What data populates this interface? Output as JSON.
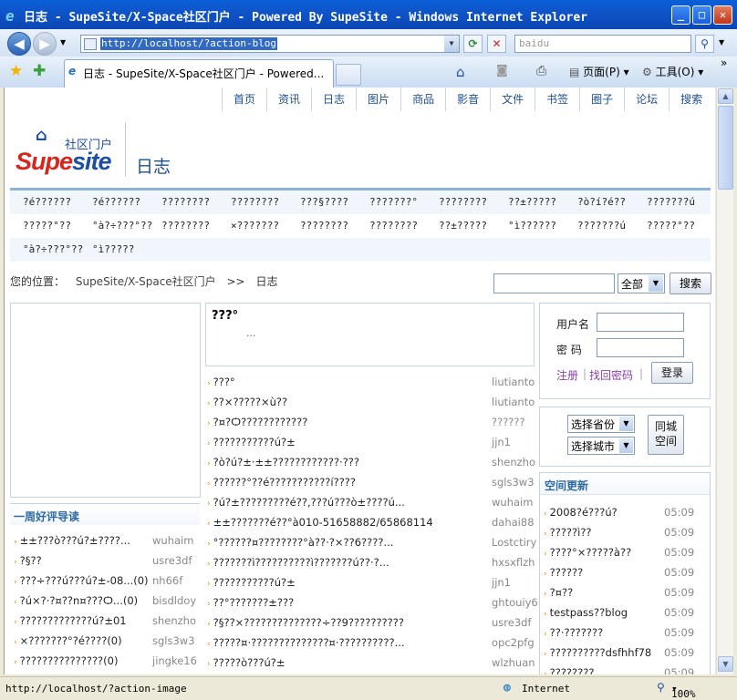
{
  "window": {
    "title": "日志 - SupeSite/X-Space社区门户 - Powered By SupeSite - Windows Internet Explorer"
  },
  "browser": {
    "address": "http://localhost/?action-blog",
    "search_placeholder": "baidu",
    "tab_title": "日志 - SupeSite/X-Space社区门户 - Powered...",
    "page_menu": "页面(P)",
    "tools_menu": "工具(O)",
    "status_url": "http://localhost/?action-image",
    "zone": "Internet",
    "zoom": "100%"
  },
  "site": {
    "nav": [
      "首页",
      "资讯",
      "日志",
      "图片",
      "商品",
      "影音",
      "文件",
      "书签",
      "圈子",
      "论坛",
      "搜索"
    ],
    "logo_cn": "社区门户",
    "logo_supe": "Supe",
    "logo_site": "site",
    "page_title": "日志",
    "categories": [
      [
        "?é??????",
        "?é??????",
        "????????",
        "????????",
        "???§????",
        "???????°",
        "????????",
        "??±?????",
        "?ò?í?é??",
        "???????ú"
      ],
      [
        "?????°??",
        "°à?÷???°??",
        "????????",
        "×???????",
        "????????",
        "????????",
        "??±?????",
        "°ì??????",
        "???????ú",
        "?????°??"
      ],
      [
        "°à?÷???°??",
        "°ì?????"
      ]
    ],
    "breadcrumb": {
      "label": "您的位置：",
      "home": "SupeSite/X-Space社区门户",
      "sep": ">>",
      "current": "日志"
    },
    "search": {
      "select": "全部",
      "button": "搜索"
    }
  },
  "left": {
    "heading": "一周好评导读",
    "items": [
      {
        "t": "±±???ò???ú?±????...",
        "n": "wuhaim"
      },
      {
        "t": "?§??",
        "n": "usre3df"
      },
      {
        "t": "???÷???ú???ú?±-08...(0)",
        "n": "nh66f"
      },
      {
        "t": "?ú×?·?¤??n¤???Ѻ...(0)",
        "n": "bisdldoy"
      },
      {
        "t": "?????????????ú?±01",
        "n": "shenzho"
      },
      {
        "t": "×???????°?é????(0)",
        "n": "sgls3w3"
      },
      {
        "t": "???????????????(0)",
        "n": "jingke16"
      }
    ]
  },
  "middle": {
    "head_title": "???°",
    "head_sub": "...",
    "items": [
      {
        "t": "???°",
        "n": "liutianto"
      },
      {
        "t": "??×?????×ù??",
        "n": "liutianto"
      },
      {
        "t": "?¤?Ѻ????????????",
        "n": "??????"
      },
      {
        "t": "???????????ú?±",
        "n": "jjn1"
      },
      {
        "t": "?ò?ú?±·±±????????????·???",
        "n": "shenzho"
      },
      {
        "t": "??????°??é???????????í????",
        "n": "sgls3w3"
      },
      {
        "t": "?ú?±?????????é??,???ú???ò±????ú...",
        "n": "wuhaim"
      },
      {
        "t": "±±???????é??°à010-51658882/65868114",
        "n": "dahai88"
      },
      {
        "t": "°??????¤????????°à??·?×??6????...",
        "n": "Lostctiry"
      },
      {
        "t": "???????ì??????????ì???????ú??·?...",
        "n": "hxsxflzh"
      },
      {
        "t": "???????????ú?±",
        "n": "jjn1"
      },
      {
        "t": "??°???????±???",
        "n": "ghtouiy6"
      },
      {
        "t": "?§??×??????????????÷??9??????????",
        "n": "usre3df"
      },
      {
        "t": "?????¤·??????????????¤·??????????...",
        "n": "opc2pfg"
      },
      {
        "t": "?????ò???ú?±",
        "n": "wlzhuan"
      }
    ]
  },
  "login": {
    "user_label": "用户名",
    "pass_label": "密  码",
    "register": "注册",
    "forgot": "找回密码",
    "submit": "登录"
  },
  "city": {
    "province": "选择省份",
    "city": "选择城市",
    "button_line1": "同城",
    "button_line2": "空间"
  },
  "space": {
    "heading": "空间更新",
    "items": [
      {
        "t": "2008?é???ú?",
        "time": "05:09"
      },
      {
        "t": "?????ì??",
        "time": "05:09"
      },
      {
        "t": "????°×?????à??",
        "time": "05:09"
      },
      {
        "t": "??????",
        "time": "05:09"
      },
      {
        "t": "?¤??",
        "time": "05:09"
      },
      {
        "t": "testpass??blog",
        "time": "05:09"
      },
      {
        "t": "??·???????",
        "time": "05:09"
      },
      {
        "t": "??????????dsfhhf78",
        "time": "05:09"
      },
      {
        "t": "????????",
        "time": "05:09"
      }
    ]
  }
}
